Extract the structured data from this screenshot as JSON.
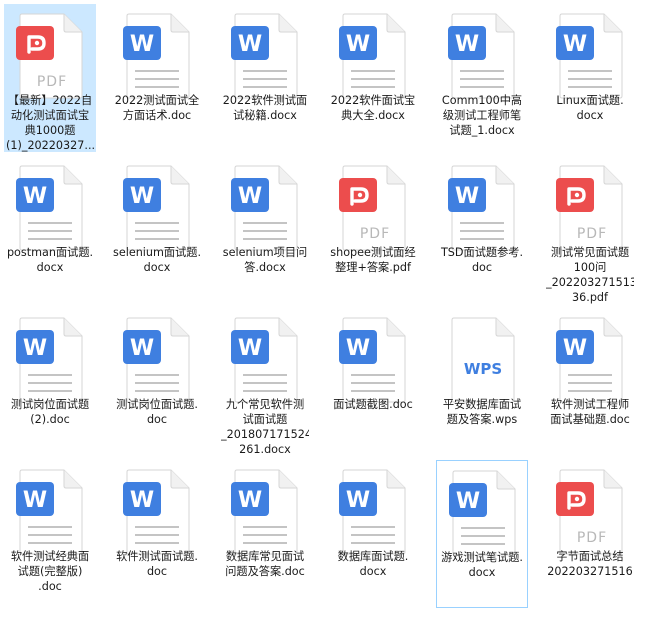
{
  "colors": {
    "word": "#3f7fe0",
    "pdf": "#ec4d4d",
    "wps": "#3f7fe0",
    "doc_lines": "#c4c4c4",
    "pdf_text": "#b8b8b8",
    "selection": "#cce8ff"
  },
  "files": [
    {
      "type": "pdf",
      "icon": "pdf-file-icon",
      "lines": [
        "【最新】2022自",
        "动化测试面试宝",
        "典1000题",
        "(1)_20220327..."
      ],
      "selected": true
    },
    {
      "type": "word",
      "icon": "word-file-icon",
      "lines": [
        "2022测试面试全",
        "方面话术.doc"
      ]
    },
    {
      "type": "word",
      "icon": "word-file-icon",
      "lines": [
        "2022软件测试面",
        "试秘籍.docx"
      ]
    },
    {
      "type": "word",
      "icon": "word-file-icon",
      "lines": [
        "2022软件面试宝",
        "典大全.docx"
      ]
    },
    {
      "type": "word",
      "icon": "word-file-icon",
      "lines": [
        "Comm100中高",
        "级测试工程师笔",
        "试题_1.docx"
      ]
    },
    {
      "type": "word",
      "icon": "word-file-icon",
      "lines": [
        "Linux面试题.",
        "docx"
      ]
    },
    {
      "type": "word",
      "icon": "word-file-icon",
      "lines": [
        "postman面试题.",
        "docx"
      ]
    },
    {
      "type": "word",
      "icon": "word-file-icon",
      "lines": [
        "selenium面试题.",
        "docx"
      ]
    },
    {
      "type": "word",
      "icon": "word-file-icon",
      "lines": [
        "selenium项目问",
        "答.docx"
      ]
    },
    {
      "type": "pdf",
      "icon": "pdf-file-icon",
      "lines": [
        "shopee测试面经",
        "整理+答案.pdf"
      ]
    },
    {
      "type": "word",
      "icon": "word-file-icon",
      "lines": [
        "TSD面试题参考.",
        "doc"
      ]
    },
    {
      "type": "pdf",
      "icon": "pdf-file-icon",
      "lines": [
        "测试常见面试题",
        "100问",
        "_202203271513",
        "36.pdf"
      ]
    },
    {
      "type": "word",
      "icon": "word-file-icon",
      "lines": [
        "测试岗位面试题",
        "(2).doc"
      ]
    },
    {
      "type": "word",
      "icon": "word-file-icon",
      "lines": [
        "测试岗位面试题.",
        "doc"
      ]
    },
    {
      "type": "word",
      "icon": "word-file-icon",
      "lines": [
        "九个常见软件测",
        "试面试题",
        "_201807171524",
        "261.docx"
      ]
    },
    {
      "type": "word",
      "icon": "word-file-icon",
      "lines": [
        "面试题截图.doc"
      ]
    },
    {
      "type": "wps",
      "icon": "wps-file-icon",
      "lines": [
        "平安数据库面试",
        "题及答案.wps"
      ]
    },
    {
      "type": "word",
      "icon": "word-file-icon",
      "lines": [
        "软件测试工程师",
        "面试基础题.doc"
      ]
    },
    {
      "type": "word",
      "icon": "word-file-icon",
      "lines": [
        "软件测试经典面",
        "试题(完整版)",
        ".doc"
      ]
    },
    {
      "type": "word",
      "icon": "word-file-icon",
      "lines": [
        "软件测试面试题.",
        "doc"
      ]
    },
    {
      "type": "word",
      "icon": "word-file-icon",
      "lines": [
        "数据库常见面试",
        "问题及答案.doc"
      ]
    },
    {
      "type": "word",
      "icon": "word-file-icon",
      "lines": [
        "数据库面试题.",
        "docx"
      ]
    },
    {
      "type": "word",
      "icon": "word-file-icon",
      "lines": [
        "游戏测试笔试题.",
        "docx"
      ],
      "focused": true
    },
    {
      "type": "pdf",
      "icon": "pdf-file-icon",
      "lines": [
        "字节面试总结",
        "202203271516"
      ]
    }
  ],
  "labels": {
    "pdf_text": "PDF",
    "wps_text": "WPS",
    "word_glyph": "W"
  }
}
